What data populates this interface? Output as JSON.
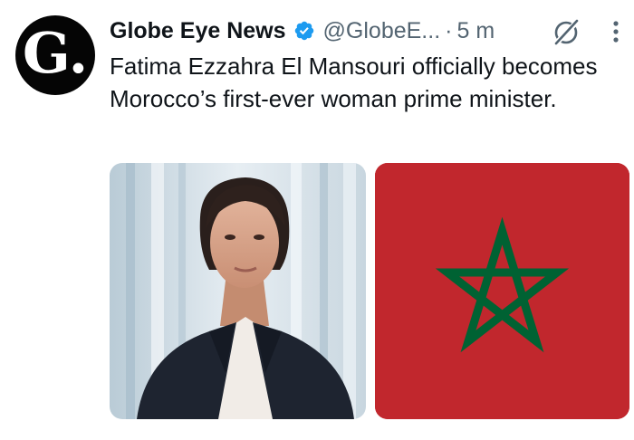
{
  "tweet": {
    "author": {
      "display_name": "Globe Eye News",
      "handle": "@GlobeE...",
      "verified": true,
      "avatar_letter": "G."
    },
    "separator": "·",
    "time": "5 m",
    "text": "Fatima Ezzahra El Mansouri officially becomes Morocco’s first-ever woman prime minister.",
    "media": [
      {
        "kind": "portrait-photo"
      },
      {
        "kind": "flag-of-morocco"
      }
    ]
  },
  "icons": {
    "verified": "verified-badge-icon",
    "grok": "grok-icon",
    "more": "more-vertical-icon"
  },
  "colors": {
    "text_primary": "#0f1419",
    "text_secondary": "#536471",
    "verified_blue": "#1d9bf0",
    "flag_red": "#c1272d",
    "flag_green": "#006233"
  }
}
